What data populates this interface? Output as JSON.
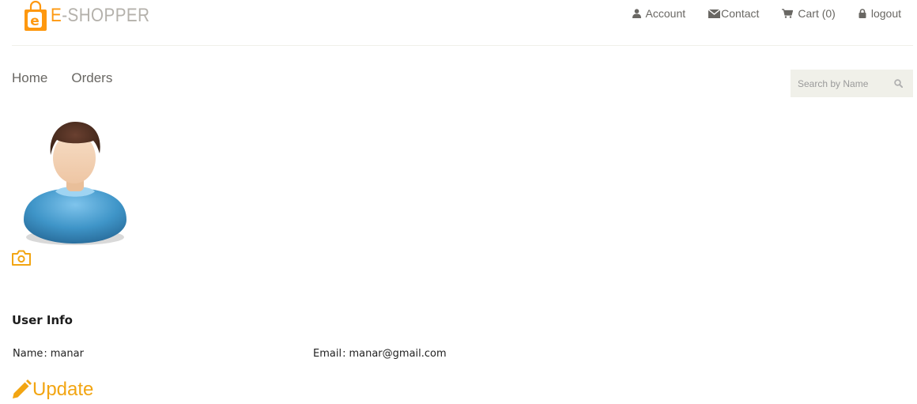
{
  "brand": {
    "logo_letter": "e",
    "name_prefix": "E",
    "name_rest": "-SHOPPER"
  },
  "top_nav": {
    "account": "Account",
    "contact": "Contact",
    "cart": "Cart (0)",
    "logout": "logout"
  },
  "main_nav": {
    "home": "Home",
    "orders": "Orders"
  },
  "search": {
    "placeholder": "Search by Name"
  },
  "user_info": {
    "title": "User Info",
    "name_label": "Name",
    "name_value": "manar",
    "email_label": "Email",
    "email_value": "manar@gmail.com",
    "separator": ":"
  },
  "update_label": "Update",
  "colors": {
    "accent": "#fe980f",
    "update": "#f2a512",
    "nav_text": "#696763",
    "search_bg": "#f0f0e9"
  }
}
